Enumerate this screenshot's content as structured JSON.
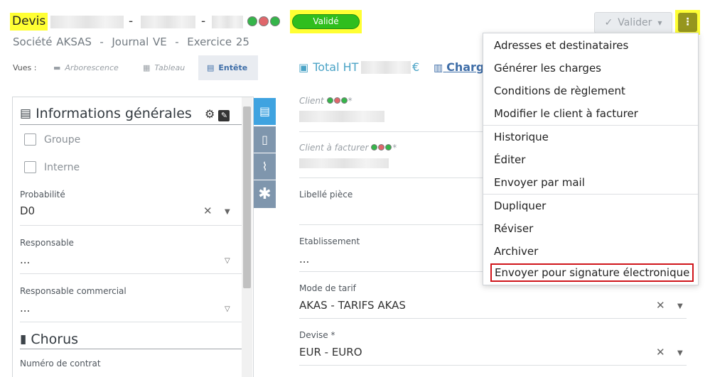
{
  "header": {
    "title": "Devis",
    "separator": "-",
    "status_badge": "Validé",
    "subtitle": "Société AKSAS  -  Journal VE  -  Exercice 25"
  },
  "views": {
    "label": "Vues :",
    "tabs": [
      {
        "label": "Arborescence",
        "icon": "folder-icon"
      },
      {
        "label": "Tableau",
        "icon": "table-icon"
      },
      {
        "label": "Entête",
        "icon": "header-doc-icon"
      }
    ]
  },
  "totals": {
    "total_label": "Total HT",
    "currency": "€",
    "charges_label": "Charg"
  },
  "toolbar": {
    "validate_label": "Valider",
    "more_label": "⋮"
  },
  "left_panel": {
    "section1_title": "Informations générales",
    "checkbox_groupe": "Groupe",
    "checkbox_interne": "Interne",
    "probabilite_label": "Probabilité",
    "probabilite_value": "D0",
    "responsable_label": "Responsable",
    "responsable_value": "...",
    "resp_commercial_label": "Responsable commercial",
    "resp_commercial_value": "...",
    "section2_title": "Chorus",
    "contrat_label": "Numéro de contrat"
  },
  "form": {
    "client_label": "Client",
    "client_a_facturer_label": "Client à facturer",
    "required_mark": "*",
    "libelle_label": "Libellé pièce",
    "etablissement_label": "Etablissement",
    "etablissement_value": "...",
    "mode_tarif_label": "Mode de tarif",
    "mode_tarif_value": "AKAS - TARIFS AKAS",
    "devise_label": "Devise *",
    "devise_value": "EUR - EURO"
  },
  "menu": {
    "items": [
      "Adresses et destinataires",
      "Générer les charges",
      "Conditions de règlement",
      "Modifier le client à facturer",
      "Historique",
      "Éditer",
      "Envoyer par mail",
      "Dupliquer",
      "Réviser",
      "Archiver",
      "Envoyer pour signature électronique"
    ]
  },
  "colors": {
    "accent": "#3f6ea8",
    "status_green": "#2fbe1e",
    "highlight": "#ffff33",
    "menu_highlight_border": "#d0151b"
  }
}
